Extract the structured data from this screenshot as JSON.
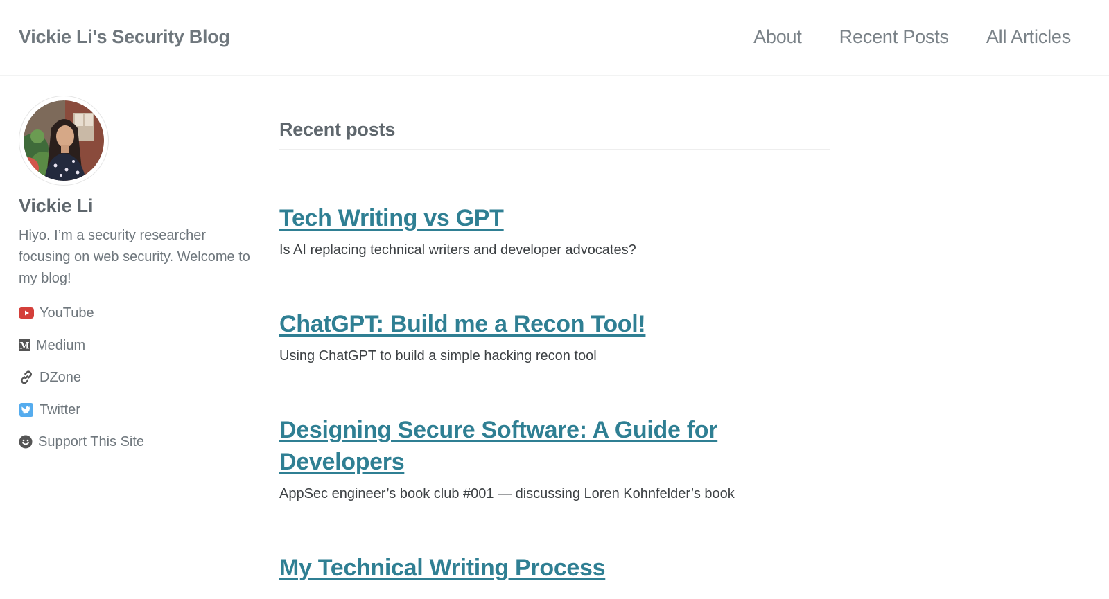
{
  "site": {
    "title": "Vickie Li's Security Blog"
  },
  "nav": [
    {
      "label": "About"
    },
    {
      "label": "Recent Posts"
    },
    {
      "label": "All Articles"
    }
  ],
  "author": {
    "name": "Vickie Li",
    "bio": "Hiyo. I’m a security researcher focusing on web security. Welcome to my blog!",
    "links": [
      {
        "label": "YouTube",
        "icon": "youtube-icon"
      },
      {
        "label": "Medium",
        "icon": "medium-icon"
      },
      {
        "label": "DZone",
        "icon": "link-icon"
      },
      {
        "label": "Twitter",
        "icon": "twitter-icon"
      },
      {
        "label": "Support This Site",
        "icon": "smile-icon"
      }
    ]
  },
  "main": {
    "section_title": "Recent posts",
    "posts": [
      {
        "title": "Tech Writing vs GPT",
        "excerpt": "Is AI replacing technical writers and developer advocates?"
      },
      {
        "title": "ChatGPT: Build me a Recon Tool!",
        "excerpt": "Using ChatGPT to build a simple hacking recon tool"
      },
      {
        "title": "Designing Secure Software: A Guide for Developers",
        "excerpt": "AppSec engineer’s book club #001 — discussing Loren Kohnfelder’s book"
      },
      {
        "title": "My Technical Writing Process",
        "excerpt": ""
      }
    ]
  },
  "colors": {
    "link": "#2f7f93",
    "youtube": "#d43f3a",
    "twitter": "#55acee"
  }
}
